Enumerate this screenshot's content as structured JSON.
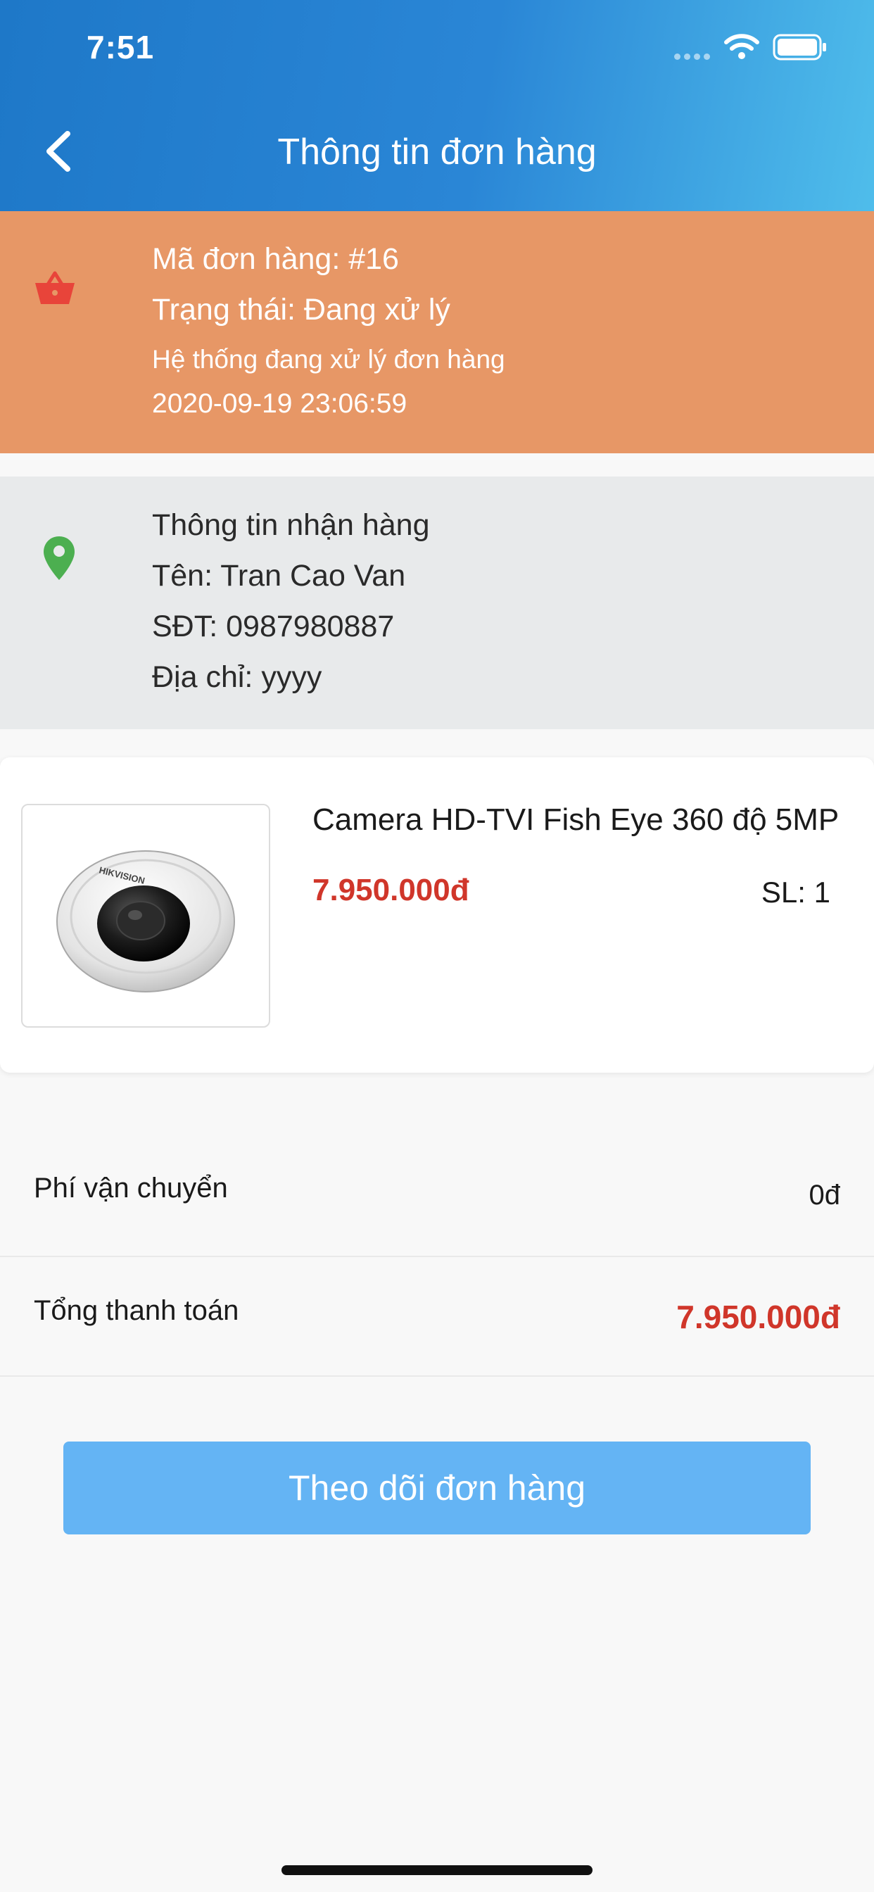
{
  "status_bar": {
    "time": "7:51"
  },
  "header": {
    "title": "Thông tin đơn hàng"
  },
  "order": {
    "code": "Mã đơn hàng: #16",
    "status": "Trạng thái: Đang xử lý",
    "note": "Hệ thống đang xử lý đơn hàng",
    "datetime": "2020-09-19 23:06:59"
  },
  "shipping": {
    "heading": "Thông tin nhận hàng",
    "name": "Tên: Tran Cao Van",
    "phone": "SĐT: 0987980887",
    "address": "Địa chỉ: yyyy"
  },
  "product": {
    "name": "Camera HD-TVI Fish Eye 360 độ 5MP",
    "price": "7.950.000đ",
    "quantity": "SL: 1",
    "brand_text": "HIKVISION"
  },
  "summary": {
    "shipping_fee_label": "Phí vận chuyển",
    "shipping_fee_value": "0đ",
    "total_label": "Tổng thanh toán",
    "total_value": "7.950.000đ"
  },
  "actions": {
    "track_order": "Theo dõi đơn hàng"
  },
  "colors": {
    "header_start": "#1e78c8",
    "header_end": "#4fbdeb",
    "order_bg": "#e79766",
    "shipping_bg": "#e8eaeb",
    "price": "#d0362a",
    "button": "#64b4f4",
    "basket_icon": "#e8443a",
    "pin_icon": "#4caf50"
  },
  "icons": [
    "back-chevron-icon",
    "basket-icon",
    "location-pin-icon",
    "wifi-icon",
    "battery-icon",
    "cellular-signal-icon"
  ]
}
